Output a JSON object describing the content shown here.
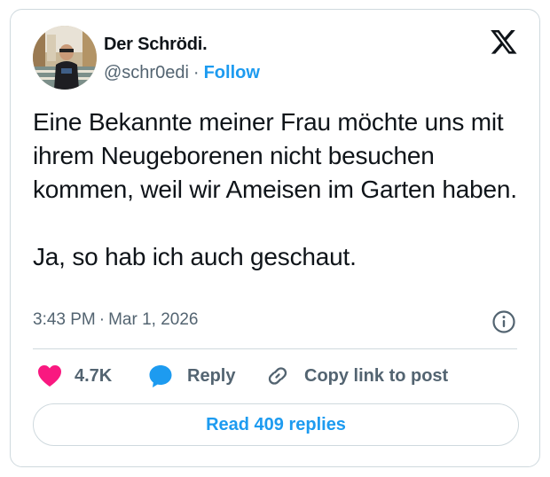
{
  "author": {
    "display_name": "Der Schrödi.",
    "handle": "@schr0edi",
    "separator": "·",
    "follow_label": "Follow"
  },
  "tweet": {
    "text": "Eine Bekannte meiner Frau möchte uns mit ihrem Neugeborenen nicht besuchen kommen, weil wir Ameisen im Garten haben.\n\nJa, so hab ich auch geschaut.",
    "time": "3:43 PM",
    "separator": "·",
    "date": "Mar 1, 2026"
  },
  "actions": {
    "like_count": "4.7K",
    "reply_label": "Reply",
    "copy_label": "Copy link to post"
  },
  "read_replies_label": "Read 409 replies",
  "colors": {
    "accent": "#1d9bf0",
    "like": "#f91880",
    "secondary_text": "#536471",
    "border": "#cfd9de"
  },
  "icons": [
    "x-logo-icon",
    "info-icon",
    "heart-icon",
    "reply-bubble-icon",
    "link-icon"
  ]
}
